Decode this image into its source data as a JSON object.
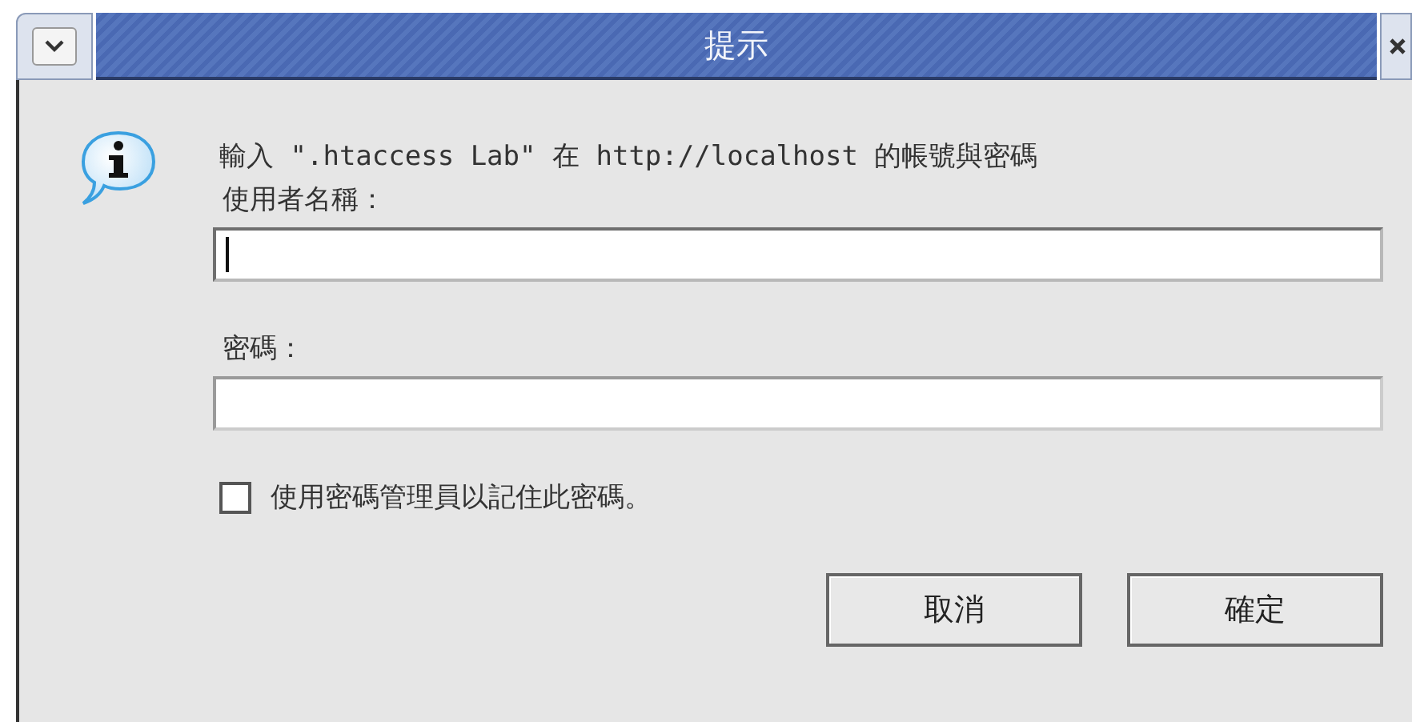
{
  "window": {
    "title": "提示"
  },
  "message": "輸入 \".htaccess Lab\" 在 http://localhost 的帳號與密碼",
  "fields": [
    {
      "label": "使用者名稱：",
      "focused": true
    },
    {
      "label": "密碼：",
      "focused": false
    }
  ],
  "remember": {
    "label": "使用密碼管理員以記住此密碼。",
    "checked": false
  },
  "buttons": [
    {
      "label": "取消"
    },
    {
      "label": "確定"
    }
  ]
}
